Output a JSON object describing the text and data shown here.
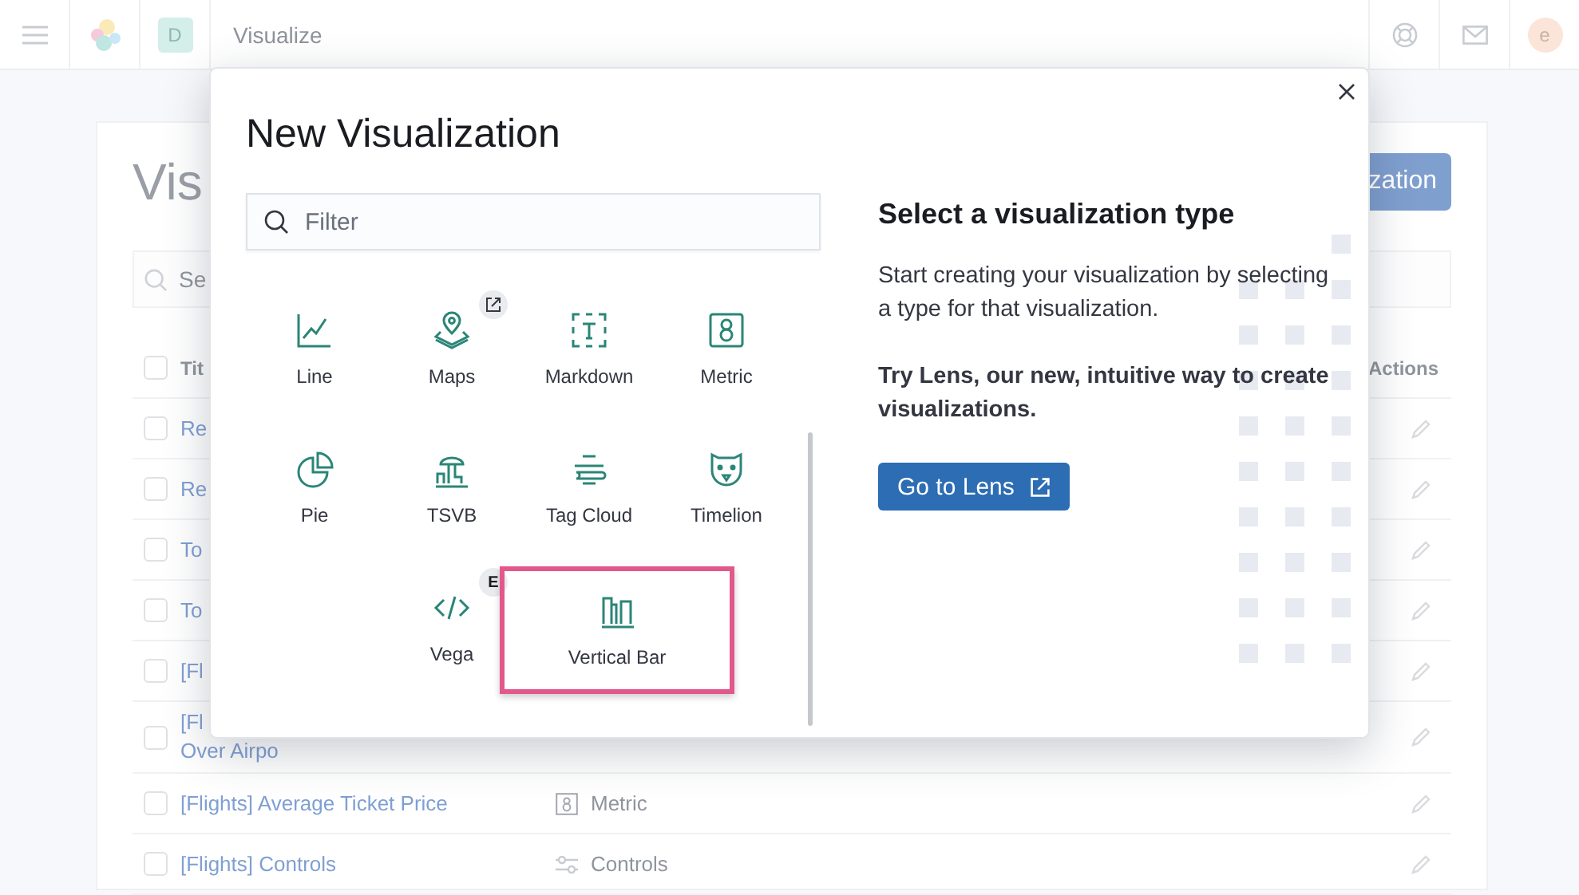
{
  "header": {
    "title": "Visualize",
    "space_avatar": "D",
    "user_avatar": "e"
  },
  "page": {
    "title": "Vis",
    "create_button": "zation",
    "search": {
      "placeholder": "Se"
    },
    "table": {
      "columns": [
        "Tit",
        "Actions"
      ],
      "all_checked": false,
      "rows": [
        {
          "checked": false,
          "title": [
            "Re"
          ]
        },
        {
          "checked": false,
          "title": [
            "Re"
          ]
        },
        {
          "checked": false,
          "title": [
            "To"
          ]
        },
        {
          "checked": false,
          "title": [
            "To"
          ]
        },
        {
          "checked": false,
          "title": [
            "[Fl"
          ]
        },
        {
          "checked": false,
          "title": [
            "[Fl",
            "Over Airpo"
          ]
        },
        {
          "checked": false,
          "title": [
            "[Flights] Average Ticket Price"
          ],
          "type": {
            "kind": "metric",
            "label": "Metric"
          }
        },
        {
          "checked": false,
          "title": [
            "[Flights] Controls"
          ],
          "type": {
            "kind": "controls",
            "label": "Controls"
          }
        }
      ]
    }
  },
  "modal": {
    "title": "New Visualization",
    "filter": {
      "placeholder": "Filter"
    },
    "type_rows": [
      [
        {
          "label": "Line",
          "kind": "line",
          "highlighted": false
        },
        {
          "label": "Maps",
          "kind": "maps",
          "highlighted": false,
          "badge": {
            "kind": "external"
          }
        },
        {
          "label": "Markdown",
          "kind": "markdown",
          "highlighted": false
        },
        {
          "label": "Metric",
          "kind": "metric",
          "highlighted": false
        }
      ],
      [
        {
          "label": "Pie",
          "kind": "pie",
          "highlighted": false
        },
        {
          "label": "TSVB",
          "kind": "tsvb",
          "highlighted": false
        },
        {
          "label": "Tag Cloud",
          "kind": "tagcloud",
          "highlighted": false
        },
        {
          "label": "Timelion",
          "kind": "timelion",
          "highlighted": false
        }
      ],
      [
        {
          "label": "Vega",
          "kind": "vega",
          "highlighted": false,
          "badge": {
            "kind": "text",
            "text": "E"
          }
        },
        {
          "label": "Vertical Bar",
          "kind": "verticalbar",
          "highlighted": true
        }
      ]
    ],
    "info": {
      "title": "Select a visualization type",
      "text": "Start creating your visualization by selecting a type for that visualization.",
      "lens_text": "Try Lens, our new, intuitive way to create visualizations.",
      "lens_button": "Go to Lens"
    }
  }
}
